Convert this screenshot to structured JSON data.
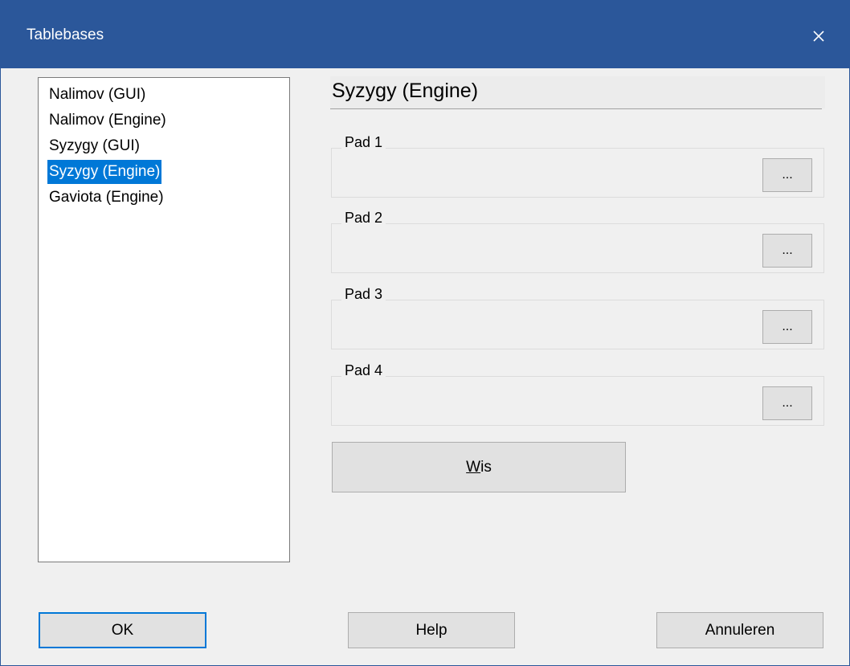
{
  "window": {
    "title": "Tablebases",
    "close_glyph": "✕"
  },
  "list": {
    "items": [
      {
        "label": "Nalimov (GUI)",
        "selected": false
      },
      {
        "label": "Nalimov (Engine)",
        "selected": false
      },
      {
        "label": "Syzygy (GUI)",
        "selected": false
      },
      {
        "label": "Syzygy (Engine)",
        "selected": true
      },
      {
        "label": "Gaviota (Engine)",
        "selected": false
      }
    ]
  },
  "panel": {
    "title": "Syzygy (Engine)",
    "groups": [
      {
        "label": "Pad 1",
        "button": "..."
      },
      {
        "label": "Pad 2",
        "button": "..."
      },
      {
        "label": "Pad 3",
        "button": "..."
      },
      {
        "label": "Pad 4",
        "button": "..."
      }
    ],
    "clear_button": {
      "mnemonic": "W",
      "rest": "is"
    }
  },
  "footer": {
    "ok": "OK",
    "help": "Help",
    "cancel": "Annuleren"
  },
  "colors": {
    "titlebar": "#2b579a",
    "selection": "#0078d7",
    "dialog_bg": "#f0f0f0"
  }
}
